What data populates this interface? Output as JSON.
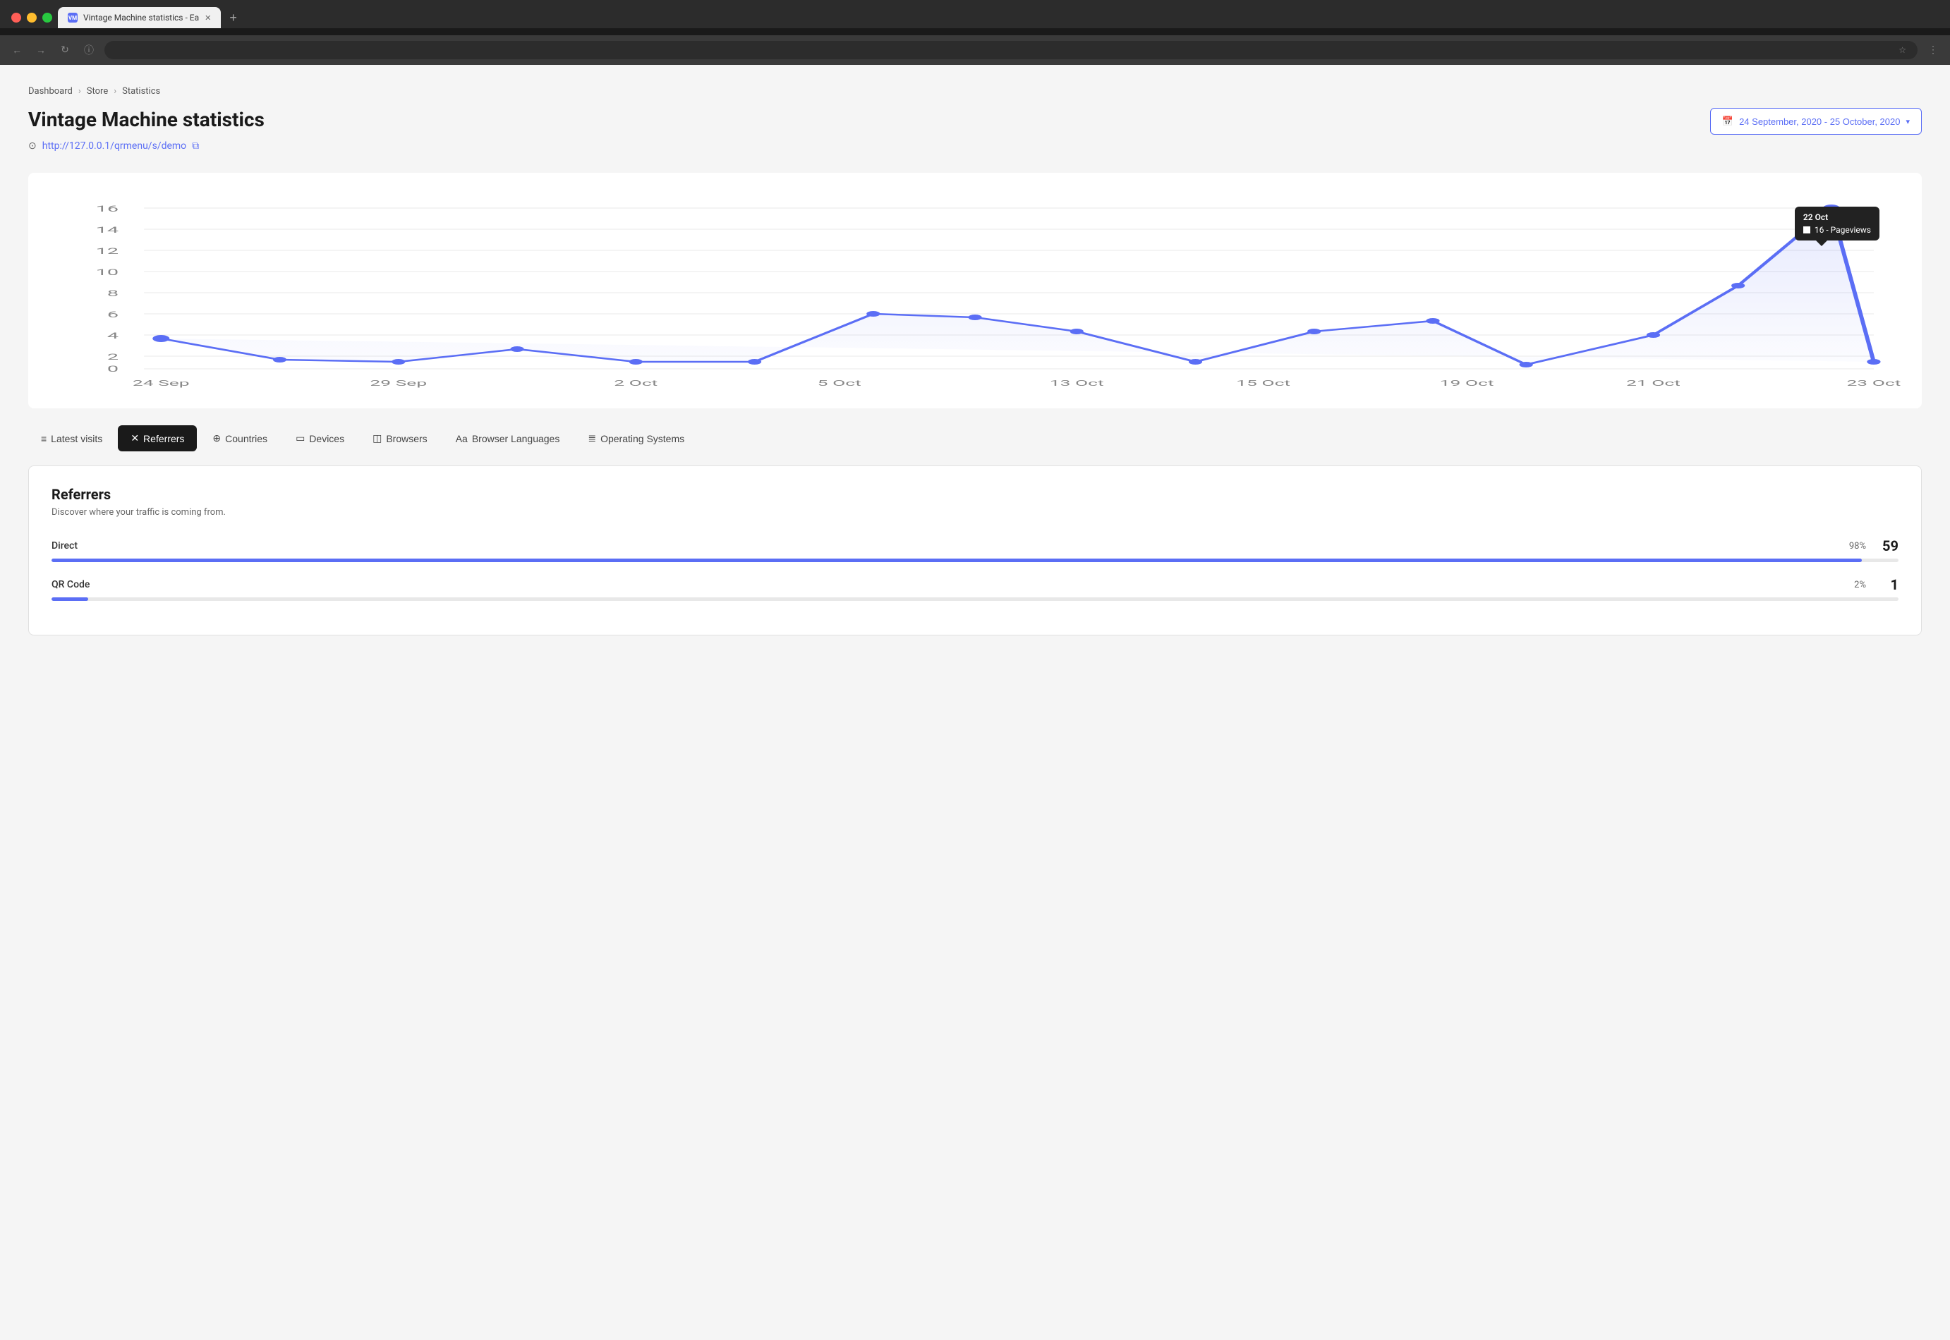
{
  "browser": {
    "tab_title": "Vintage Machine statistics - Ea",
    "tab_favicon": "VM",
    "address": "",
    "nav_back": "←",
    "nav_forward": "→",
    "nav_reload": "↻",
    "nav_info": "ⓘ",
    "nav_star": "☆",
    "nav_menu": "⋮"
  },
  "breadcrumb": {
    "items": [
      "Dashboard",
      "Store",
      "Statistics"
    ],
    "sep": ">"
  },
  "page": {
    "title": "Vintage Machine statistics",
    "url": "http://127.0.0.1/qrmenu/s/demo",
    "date_range": "24 September, 2020 - 25 October, 2020"
  },
  "chart": {
    "tooltip": {
      "date": "22 Oct",
      "value": "16 - Pageviews"
    },
    "y_labels": [
      "0",
      "2",
      "4",
      "6",
      "8",
      "10",
      "12",
      "14",
      "16"
    ],
    "x_labels": [
      "24 Sep",
      "29 Sep",
      "2 Oct",
      "5 Oct",
      "13 Oct",
      "15 Oct",
      "19 Oct",
      "21 Oct",
      "23 Oct"
    ]
  },
  "tabs": [
    {
      "id": "latest-visits",
      "label": "Latest visits",
      "icon": "≡"
    },
    {
      "id": "referrers",
      "label": "Referrers",
      "icon": "✕",
      "active": true
    },
    {
      "id": "countries",
      "label": "Countries",
      "icon": "⊕"
    },
    {
      "id": "devices",
      "label": "Devices",
      "icon": "▭"
    },
    {
      "id": "browsers",
      "label": "Browsers",
      "icon": "◫"
    },
    {
      "id": "browser-languages",
      "label": "Browser Languages",
      "icon": "Aa"
    },
    {
      "id": "operating-systems",
      "label": "Operating Systems",
      "icon": "≣"
    }
  ],
  "referrers": {
    "title": "Referrers",
    "subtitle": "Discover where your traffic is coming from.",
    "items": [
      {
        "name": "Direct",
        "pct": "98%",
        "count": "59",
        "fill": 98
      },
      {
        "name": "QR Code",
        "pct": "2%",
        "count": "1",
        "fill": 2
      }
    ]
  }
}
